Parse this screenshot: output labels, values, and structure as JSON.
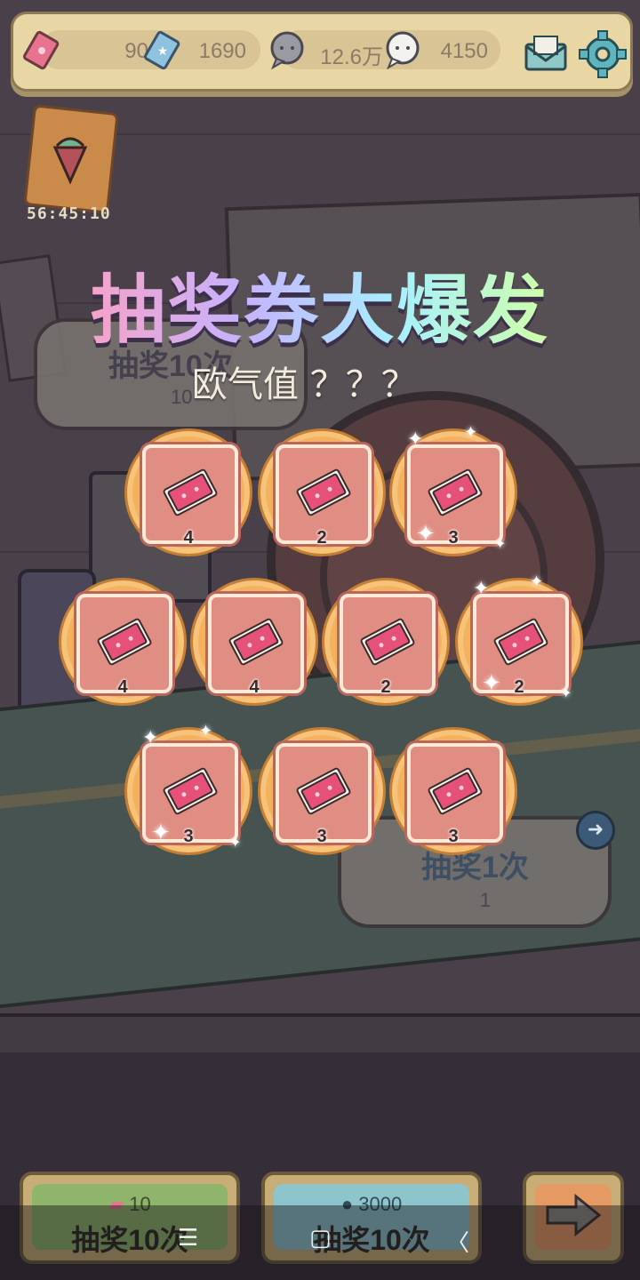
{
  "currency": {
    "tickets": "90",
    "blue_tickets": "1690",
    "speech_grey": "12.6万",
    "speech_white": "4150"
  },
  "event": {
    "timer": "56:45:10"
  },
  "title": "抽奖券大爆发",
  "luck": "欧气值 ？？？",
  "background_panels": {
    "left_title": "抽奖10次",
    "left_cost": "10",
    "right_title": "抽奖1次",
    "right_cost": "1"
  },
  "rewards": [
    {
      "count": "4"
    },
    {
      "count": "2"
    },
    {
      "count": "3"
    },
    {
      "count": "4"
    },
    {
      "count": "4"
    },
    {
      "count": "2"
    },
    {
      "count": "2"
    },
    {
      "count": "3"
    },
    {
      "count": "3"
    },
    {
      "count": "3"
    }
  ],
  "buttons": {
    "draw_ticket": {
      "cost": "10",
      "label": "抽奖10次"
    },
    "draw_coin": {
      "cost": "3000",
      "label": "抽奖10次"
    }
  },
  "nav": {
    "menu": "☰",
    "home": "▢",
    "back": "〈"
  },
  "colors": {
    "title_gradient": [
      "#f6a3c9",
      "#c6b2ff",
      "#a7f0ff",
      "#cfffa8"
    ],
    "reward_circle": "#f5b25e",
    "ticket": "#e6517a",
    "green_button": "#8fb46b",
    "blue_button": "#8ec4cc",
    "orange_button": "#e59a63"
  }
}
